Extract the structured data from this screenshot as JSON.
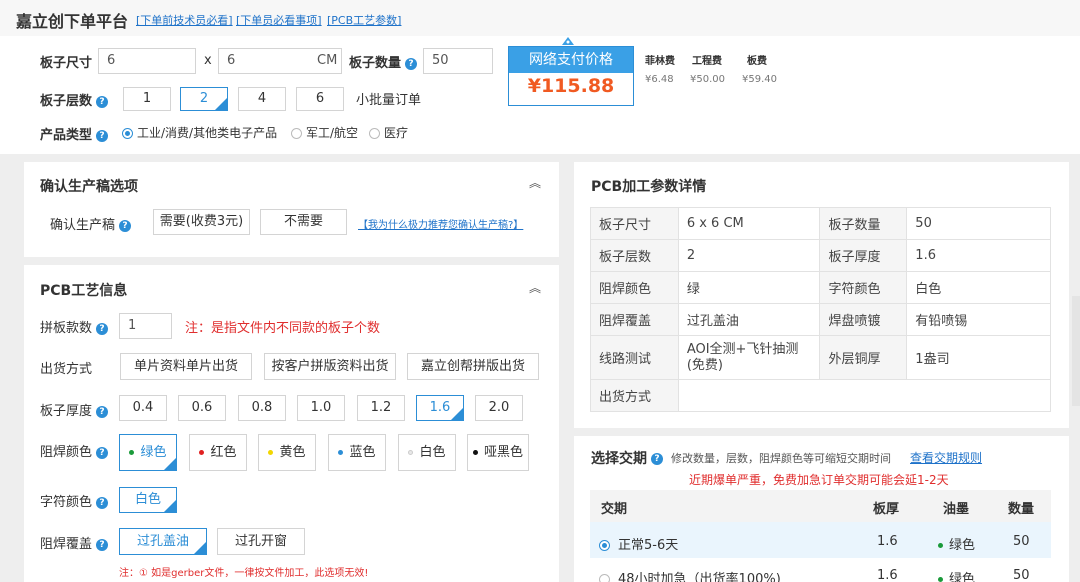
{
  "header": {
    "brand": "嘉立创下单平台",
    "links": [
      "[下单前技术员必看]",
      "[下单员必看事项]",
      "[PCB工艺参数]"
    ]
  },
  "order": {
    "size_label": "板子尺寸",
    "size_w": "6",
    "size_x": "x",
    "size_h": "6",
    "size_unit": "CM",
    "qty_label": "板子数量",
    "qty_value": "50",
    "layers_label": "板子层数",
    "layers": [
      "1",
      "2",
      "4",
      "6"
    ],
    "layers_selected": "2",
    "small_batch": "小批量订单",
    "type_label": "产品类型",
    "types": [
      "工业/消费/其他类电子产品",
      "军工/航空",
      "医疗"
    ],
    "type_selected": "工业/消费/其他类电子产品"
  },
  "price": {
    "head": "网络支付价格",
    "value": "¥115.88",
    "fees": [
      {
        "label": "菲林费",
        "value": "¥6.48"
      },
      {
        "label": "工程费",
        "value": "¥50.00"
      },
      {
        "label": "板费",
        "value": "¥59.40"
      }
    ]
  },
  "confirm": {
    "title": "确认生产稿选项",
    "row_label": "确认生产稿",
    "options": [
      "需要(收费3元)",
      "不需要"
    ],
    "link": "【我为什么极力推荐您确认生产稿?】"
  },
  "craft": {
    "title": "PCB工艺信息",
    "panel_label": "拼板款数",
    "panel_value": "1",
    "panel_note": "注：是指文件内不同款的板子个数",
    "ship_label": "出货方式",
    "ship_options": [
      "单片资料单片出货",
      "按客户拼版资料出货",
      "嘉立创帮拼版出货"
    ],
    "thick_label": "板子厚度",
    "thick_options": [
      "0.4",
      "0.6",
      "0.8",
      "1.0",
      "1.2",
      "1.6",
      "2.0"
    ],
    "thick_selected": "1.6",
    "mask_label": "阻焊颜色",
    "mask_options": [
      "绿色",
      "红色",
      "黄色",
      "蓝色",
      "白色",
      "哑黑色"
    ],
    "mask_dots": [
      "#1a9a3a",
      "#e02020",
      "#f2d600",
      "#2c8ed6",
      "#e8e8e8",
      "#111111"
    ],
    "mask_selected": "绿色",
    "silk_label": "字符颜色",
    "silk_value": "白色",
    "cover_label": "阻焊覆盖",
    "cover_options": [
      "过孔盖油",
      "过孔开窗"
    ],
    "cover_selected": "过孔盖油",
    "bottom_note": "注：① 如是gerber文件，一律按文件加工，此选项无效!"
  },
  "params": {
    "title": "PCB加工参数详情",
    "rows": [
      [
        "板子尺寸",
        "6 x 6 CM",
        "板子数量",
        "50"
      ],
      [
        "板子层数",
        "2",
        "板子厚度",
        "1.6"
      ],
      [
        "阻焊颜色",
        "绿",
        "字符颜色",
        "白色"
      ],
      [
        "阻焊覆盖",
        "过孔盖油",
        "焊盘喷镀",
        "有铅喷锡"
      ],
      [
        "线路测试",
        "AOI全测+飞针抽测(免费)",
        "外层铜厚",
        "1盎司"
      ],
      [
        "出货方式",
        "",
        "",
        ""
      ]
    ]
  },
  "delivery": {
    "title": "选择交期",
    "hint": "修改数量，层数，阻焊颜色等可缩短交期时间",
    "rule_link": "查看交期规则",
    "warning": "近期爆单严重，免费加急订单交期可能会延1-2天",
    "headers": [
      "交期",
      "板厚",
      "油墨",
      "数量"
    ],
    "rows": [
      {
        "label": "正常5-6天",
        "thick": "1.6",
        "ink": "绿色",
        "qty": "50",
        "selected": true
      },
      {
        "label": "48小时加急（出货率100%)",
        "thick": "1.6",
        "ink": "绿色",
        "qty": "50",
        "selected": false
      }
    ]
  },
  "colors": {
    "accent": "#2c8ed6",
    "price": "#f05a22",
    "warning": "#e02e2e"
  }
}
